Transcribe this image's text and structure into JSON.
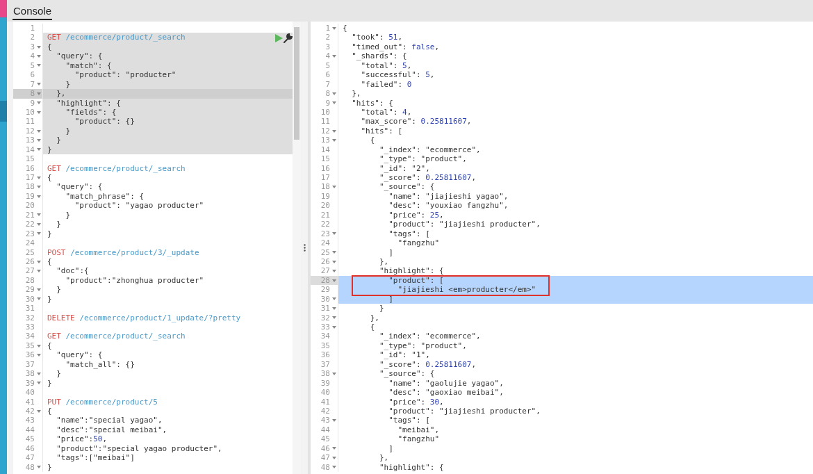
{
  "tabs": [
    {
      "label": "Console",
      "selected": true
    }
  ],
  "request_editor": {
    "lines": [
      {
        "n": "1",
        "fold": false,
        "in_request": false,
        "active": false
      },
      {
        "n": "2",
        "fold": false,
        "in_request": true,
        "active": false,
        "method": "GET",
        "path": "/ecommerce/product/_search"
      },
      {
        "n": "3",
        "fold": true,
        "in_request": true,
        "active": false,
        "text": "{"
      },
      {
        "n": "4",
        "fold": true,
        "in_request": true,
        "active": false,
        "text": "  \"query\": {"
      },
      {
        "n": "5",
        "fold": true,
        "in_request": true,
        "active": false,
        "text": "    \"match\": {"
      },
      {
        "n": "6",
        "fold": false,
        "in_request": true,
        "active": false,
        "text": "      \"product\": \"producter\""
      },
      {
        "n": "7",
        "fold": true,
        "in_request": true,
        "active": false,
        "text": "    }"
      },
      {
        "n": "8",
        "fold": true,
        "in_request": true,
        "active": true,
        "text": "  },"
      },
      {
        "n": "9",
        "fold": true,
        "in_request": true,
        "active": false,
        "text": "  \"highlight\": {"
      },
      {
        "n": "10",
        "fold": true,
        "in_request": true,
        "active": false,
        "text": "    \"fields\": {"
      },
      {
        "n": "11",
        "fold": false,
        "in_request": true,
        "active": false,
        "text": "      \"product\": {}"
      },
      {
        "n": "12",
        "fold": true,
        "in_request": true,
        "active": false,
        "text": "    }"
      },
      {
        "n": "13",
        "fold": true,
        "in_request": true,
        "active": false,
        "text": "  }"
      },
      {
        "n": "14",
        "fold": true,
        "in_request": true,
        "active": false,
        "text": "}"
      },
      {
        "n": "15",
        "fold": false,
        "in_request": false,
        "active": false
      },
      {
        "n": "16",
        "fold": false,
        "in_request": false,
        "active": false,
        "method": "GET",
        "path": "/ecommerce/product/_search"
      },
      {
        "n": "17",
        "fold": true,
        "in_request": false,
        "active": false,
        "text": "{"
      },
      {
        "n": "18",
        "fold": true,
        "in_request": false,
        "active": false,
        "text": "  \"query\": {"
      },
      {
        "n": "19",
        "fold": true,
        "in_request": false,
        "active": false,
        "text": "    \"match_phrase\": {"
      },
      {
        "n": "20",
        "fold": false,
        "in_request": false,
        "active": false,
        "text": "      \"product\": \"yagao producter\""
      },
      {
        "n": "21",
        "fold": true,
        "in_request": false,
        "active": false,
        "text": "    }"
      },
      {
        "n": "22",
        "fold": true,
        "in_request": false,
        "active": false,
        "text": "  }"
      },
      {
        "n": "23",
        "fold": true,
        "in_request": false,
        "active": false,
        "text": "}"
      },
      {
        "n": "24",
        "fold": false,
        "in_request": false,
        "active": false
      },
      {
        "n": "25",
        "fold": false,
        "in_request": false,
        "active": false,
        "method": "POST",
        "path": "/ecommerce/product/3/_update"
      },
      {
        "n": "26",
        "fold": true,
        "in_request": false,
        "active": false,
        "text": "{"
      },
      {
        "n": "27",
        "fold": true,
        "in_request": false,
        "active": false,
        "text": "  \"doc\":{"
      },
      {
        "n": "28",
        "fold": false,
        "in_request": false,
        "active": false,
        "text": "    \"product\":\"zhonghua producter\""
      },
      {
        "n": "29",
        "fold": true,
        "in_request": false,
        "active": false,
        "text": "  }"
      },
      {
        "n": "30",
        "fold": true,
        "in_request": false,
        "active": false,
        "text": "}"
      },
      {
        "n": "31",
        "fold": false,
        "in_request": false,
        "active": false
      },
      {
        "n": "32",
        "fold": false,
        "in_request": false,
        "active": false,
        "method": "DELETE",
        "path": "/ecommerce/product/1_update/?pretty"
      },
      {
        "n": "33",
        "fold": false,
        "in_request": false,
        "active": false
      },
      {
        "n": "34",
        "fold": false,
        "in_request": false,
        "active": false,
        "method": "GET",
        "path": "/ecommerce/product/_search"
      },
      {
        "n": "35",
        "fold": true,
        "in_request": false,
        "active": false,
        "text": "{"
      },
      {
        "n": "36",
        "fold": true,
        "in_request": false,
        "active": false,
        "text": "  \"query\": {"
      },
      {
        "n": "37",
        "fold": false,
        "in_request": false,
        "active": false,
        "text": "    \"match_all\": {}"
      },
      {
        "n": "38",
        "fold": true,
        "in_request": false,
        "active": false,
        "text": "  }"
      },
      {
        "n": "39",
        "fold": true,
        "in_request": false,
        "active": false,
        "text": "}"
      },
      {
        "n": "40",
        "fold": false,
        "in_request": false,
        "active": false
      },
      {
        "n": "41",
        "fold": false,
        "in_request": false,
        "active": false,
        "method": "PUT",
        "path": "/ecommerce/product/5"
      },
      {
        "n": "42",
        "fold": true,
        "in_request": false,
        "active": false,
        "text": "{"
      },
      {
        "n": "43",
        "fold": false,
        "in_request": false,
        "active": false,
        "text": "  \"name\":\"special yagao\","
      },
      {
        "n": "44",
        "fold": false,
        "in_request": false,
        "active": false,
        "text": "  \"desc\":\"special meibai\","
      },
      {
        "n": "45",
        "fold": false,
        "in_request": false,
        "active": false,
        "text": "  \"price\":50,"
      },
      {
        "n": "46",
        "fold": false,
        "in_request": false,
        "active": false,
        "text": "  \"product\":\"special yagao producter\","
      },
      {
        "n": "47",
        "fold": false,
        "in_request": false,
        "active": false,
        "text": "  \"tags\":[\"meibai\"]"
      },
      {
        "n": "48",
        "fold": true,
        "in_request": false,
        "active": false,
        "text": "}"
      }
    ]
  },
  "response_viewer": {
    "lines": [
      {
        "n": "1",
        "fold": true,
        "selected": false,
        "active": false,
        "boxed": false,
        "text": "{"
      },
      {
        "n": "2",
        "fold": false,
        "selected": false,
        "active": false,
        "boxed": false,
        "text": "  \"took\": 51,"
      },
      {
        "n": "3",
        "fold": false,
        "selected": false,
        "active": false,
        "boxed": false,
        "text": "  \"timed_out\": false,"
      },
      {
        "n": "4",
        "fold": true,
        "selected": false,
        "active": false,
        "boxed": false,
        "text": "  \"_shards\": {"
      },
      {
        "n": "5",
        "fold": false,
        "selected": false,
        "active": false,
        "boxed": false,
        "text": "    \"total\": 5,"
      },
      {
        "n": "6",
        "fold": false,
        "selected": false,
        "active": false,
        "boxed": false,
        "text": "    \"successful\": 5,"
      },
      {
        "n": "7",
        "fold": false,
        "selected": false,
        "active": false,
        "boxed": false,
        "text": "    \"failed\": 0"
      },
      {
        "n": "8",
        "fold": true,
        "selected": false,
        "active": false,
        "boxed": false,
        "text": "  },"
      },
      {
        "n": "9",
        "fold": true,
        "selected": false,
        "active": false,
        "boxed": false,
        "text": "  \"hits\": {"
      },
      {
        "n": "10",
        "fold": false,
        "selected": false,
        "active": false,
        "boxed": false,
        "text": "    \"total\": 4,"
      },
      {
        "n": "11",
        "fold": false,
        "selected": false,
        "active": false,
        "boxed": false,
        "text": "    \"max_score\": 0.25811607,"
      },
      {
        "n": "12",
        "fold": true,
        "selected": false,
        "active": false,
        "boxed": false,
        "text": "    \"hits\": ["
      },
      {
        "n": "13",
        "fold": true,
        "selected": false,
        "active": false,
        "boxed": false,
        "text": "      {"
      },
      {
        "n": "14",
        "fold": false,
        "selected": false,
        "active": false,
        "boxed": false,
        "text": "        \"_index\": \"ecommerce\","
      },
      {
        "n": "15",
        "fold": false,
        "selected": false,
        "active": false,
        "boxed": false,
        "text": "        \"_type\": \"product\","
      },
      {
        "n": "16",
        "fold": false,
        "selected": false,
        "active": false,
        "boxed": false,
        "text": "        \"_id\": \"2\","
      },
      {
        "n": "17",
        "fold": false,
        "selected": false,
        "active": false,
        "boxed": false,
        "text": "        \"_score\": 0.25811607,"
      },
      {
        "n": "18",
        "fold": true,
        "selected": false,
        "active": false,
        "boxed": false,
        "text": "        \"_source\": {"
      },
      {
        "n": "19",
        "fold": false,
        "selected": false,
        "active": false,
        "boxed": false,
        "text": "          \"name\": \"jiajieshi yagao\","
      },
      {
        "n": "20",
        "fold": false,
        "selected": false,
        "active": false,
        "boxed": false,
        "text": "          \"desc\": \"youxiao fangzhu\","
      },
      {
        "n": "21",
        "fold": false,
        "selected": false,
        "active": false,
        "boxed": false,
        "text": "          \"price\": 25,"
      },
      {
        "n": "22",
        "fold": false,
        "selected": false,
        "active": false,
        "boxed": false,
        "text": "          \"product\": \"jiajieshi producter\","
      },
      {
        "n": "23",
        "fold": true,
        "selected": false,
        "active": false,
        "boxed": false,
        "text": "          \"tags\": ["
      },
      {
        "n": "24",
        "fold": false,
        "selected": false,
        "active": false,
        "boxed": false,
        "text": "            \"fangzhu\""
      },
      {
        "n": "25",
        "fold": true,
        "selected": false,
        "active": false,
        "boxed": false,
        "text": "          ]"
      },
      {
        "n": "26",
        "fold": true,
        "selected": false,
        "active": false,
        "boxed": false,
        "text": "        },"
      },
      {
        "n": "27",
        "fold": true,
        "selected": false,
        "active": false,
        "boxed": false,
        "text": "        \"highlight\": {"
      },
      {
        "n": "28",
        "fold": true,
        "selected": true,
        "active": true,
        "boxed": true,
        "text": "          \"product\": ["
      },
      {
        "n": "29",
        "fold": false,
        "selected": true,
        "active": false,
        "boxed": true,
        "text": "            \"jiajieshi <em>producter</em>\""
      },
      {
        "n": "30",
        "fold": true,
        "selected": true,
        "active": false,
        "boxed": false,
        "text": "          ]"
      },
      {
        "n": "31",
        "fold": true,
        "selected": false,
        "active": false,
        "boxed": false,
        "text": "        }"
      },
      {
        "n": "32",
        "fold": true,
        "selected": false,
        "active": false,
        "boxed": false,
        "text": "      },"
      },
      {
        "n": "33",
        "fold": true,
        "selected": false,
        "active": false,
        "boxed": false,
        "text": "      {"
      },
      {
        "n": "34",
        "fold": false,
        "selected": false,
        "active": false,
        "boxed": false,
        "text": "        \"_index\": \"ecommerce\","
      },
      {
        "n": "35",
        "fold": false,
        "selected": false,
        "active": false,
        "boxed": false,
        "text": "        \"_type\": \"product\","
      },
      {
        "n": "36",
        "fold": false,
        "selected": false,
        "active": false,
        "boxed": false,
        "text": "        \"_id\": \"1\","
      },
      {
        "n": "37",
        "fold": false,
        "selected": false,
        "active": false,
        "boxed": false,
        "text": "        \"_score\": 0.25811607,"
      },
      {
        "n": "38",
        "fold": true,
        "selected": false,
        "active": false,
        "boxed": false,
        "text": "        \"_source\": {"
      },
      {
        "n": "39",
        "fold": false,
        "selected": false,
        "active": false,
        "boxed": false,
        "text": "          \"name\": \"gaolujie yagao\","
      },
      {
        "n": "40",
        "fold": false,
        "selected": false,
        "active": false,
        "boxed": false,
        "text": "          \"desc\": \"gaoxiao meibai\","
      },
      {
        "n": "41",
        "fold": false,
        "selected": false,
        "active": false,
        "boxed": false,
        "text": "          \"price\": 30,"
      },
      {
        "n": "42",
        "fold": false,
        "selected": false,
        "active": false,
        "boxed": false,
        "text": "          \"product\": \"jiajieshi producter\","
      },
      {
        "n": "43",
        "fold": true,
        "selected": false,
        "active": false,
        "boxed": false,
        "text": "          \"tags\": ["
      },
      {
        "n": "44",
        "fold": false,
        "selected": false,
        "active": false,
        "boxed": false,
        "text": "            \"meibai\","
      },
      {
        "n": "45",
        "fold": false,
        "selected": false,
        "active": false,
        "boxed": false,
        "text": "            \"fangzhu\""
      },
      {
        "n": "46",
        "fold": true,
        "selected": false,
        "active": false,
        "boxed": false,
        "text": "          ]"
      },
      {
        "n": "47",
        "fold": true,
        "selected": false,
        "active": false,
        "boxed": false,
        "text": "        },"
      },
      {
        "n": "48",
        "fold": true,
        "selected": false,
        "active": false,
        "boxed": false,
        "text": "        \"highlight\": {"
      }
    ]
  }
}
